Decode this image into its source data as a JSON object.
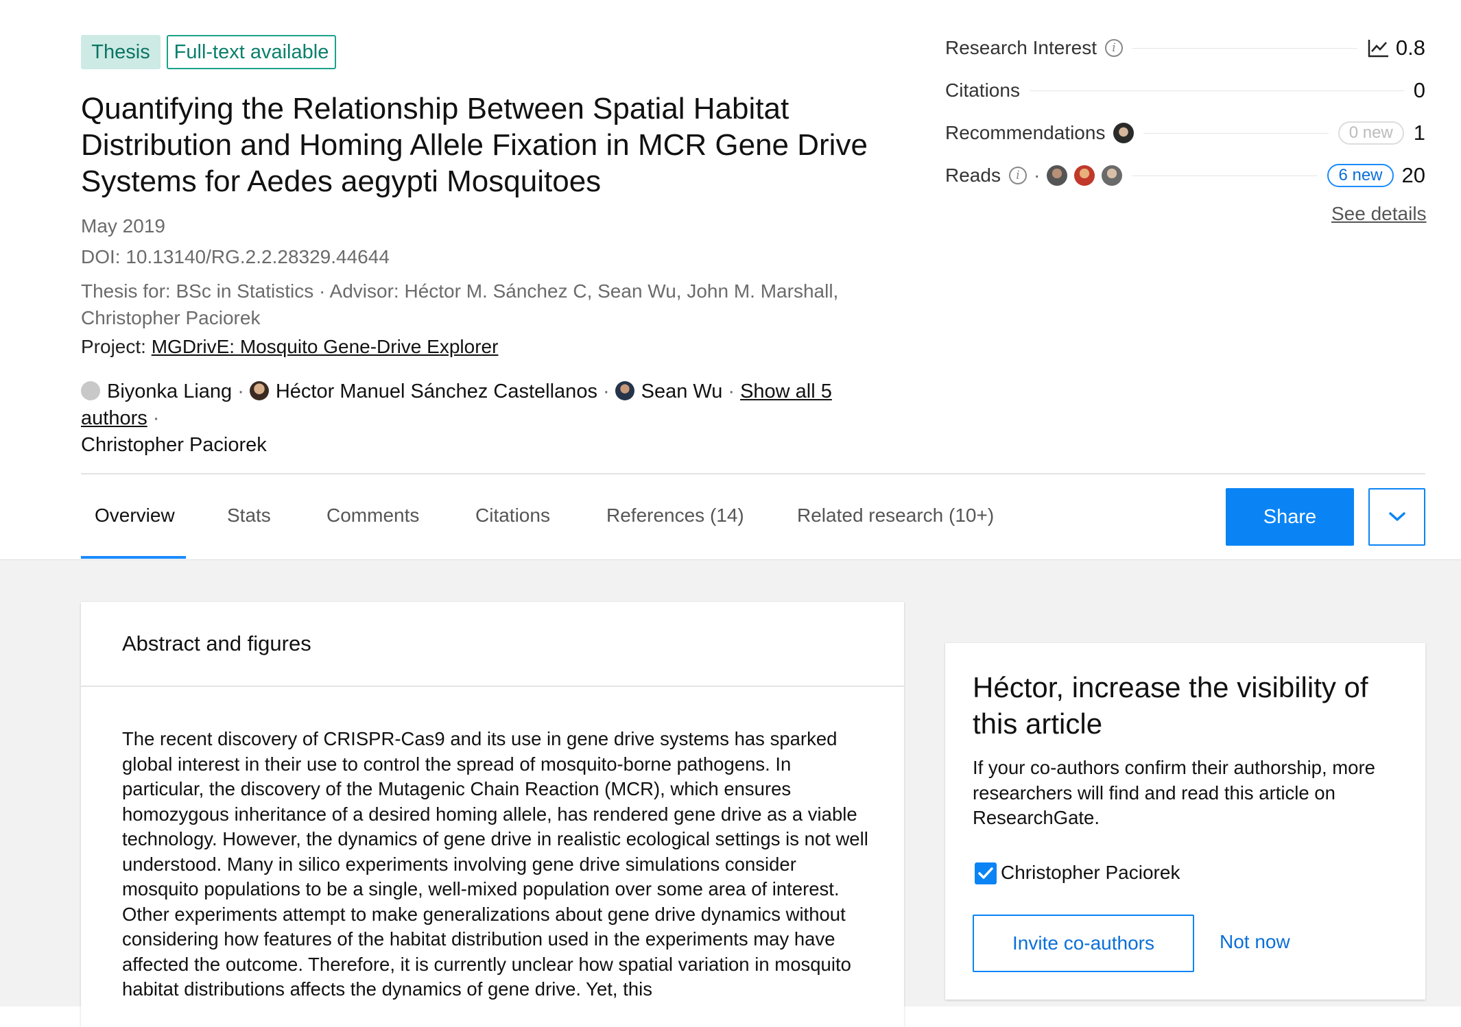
{
  "badges": {
    "type": "Thesis",
    "availability": "Full-text available"
  },
  "title": "Quantifying the Relationship Between Spatial Habitat Distribution and Homing Allele Fixation in MCR Gene Drive Systems for Aedes aegypti Mosquitoes",
  "meta": {
    "date": "May 2019",
    "doi": "DOI: 10.13140/RG.2.2.28329.44644",
    "thesis_line_1": "Thesis for: BSc in Statistics · Advisor: Héctor M. Sánchez C, Sean Wu, John M. Marshall,",
    "thesis_line_2": "Christopher Paciorek",
    "project_label": "Project:",
    "project_link": "MGDrivE: Mosquito Gene-Drive Explorer"
  },
  "authors": {
    "a1": "Biyonka Liang",
    "a2": "Héctor Manuel Sánchez Castellanos",
    "a3": "Sean Wu",
    "show_all": "Show all 5 authors",
    "a_last": "Christopher Paciorek",
    "separator": "·"
  },
  "stats": {
    "research_interest": {
      "label": "Research Interest",
      "value": "0.8"
    },
    "citations": {
      "label": "Citations",
      "value": "0"
    },
    "recommendations": {
      "label": "Recommendations",
      "new": "0 new",
      "value": "1"
    },
    "reads": {
      "label": "Reads",
      "new": "6 new",
      "value": "20"
    },
    "see_details": "See details"
  },
  "tabs": {
    "overview": "Overview",
    "stats": "Stats",
    "comments": "Comments",
    "citations": "Citations",
    "references": "References (14)",
    "related": "Related research (10+)"
  },
  "actions": {
    "share": "Share"
  },
  "abstract": {
    "heading": "Abstract and figures",
    "text": "The recent discovery of CRISPR-Cas9 and its use in gene drive systems has sparked global interest in their use to control the spread of mosquito-borne pathogens. In particular, the discovery of the Mutagenic Chain Reaction (MCR), which ensures homozygous inheritance of a desired homing allele, has rendered gene drive as a viable technology. However, the dynamics of gene drive in realistic ecological settings is not well understood. Many in silico experiments involving gene drive simulations consider mosquito populations to be a single, well-mixed population over some area of interest. Other experiments attempt to make generalizations about gene drive dynamics without considering how features of the habitat distribution used in the experiments may have affected the outcome. Therefore, it is currently unclear how spatial variation in mosquito habitat distributions affects the dynamics of gene drive. Yet, this"
  },
  "visibility": {
    "title": "Héctor, increase the visibility of this article",
    "text": "If your co-authors confirm their authorship, more researchers will find and read this article on ResearchGate.",
    "checkbox_label": "Christopher Paciorek",
    "invite": "Invite co-authors",
    "not_now": "Not now"
  },
  "colors": {
    "accent": "#0a84f5",
    "teal": "#19a28a"
  }
}
